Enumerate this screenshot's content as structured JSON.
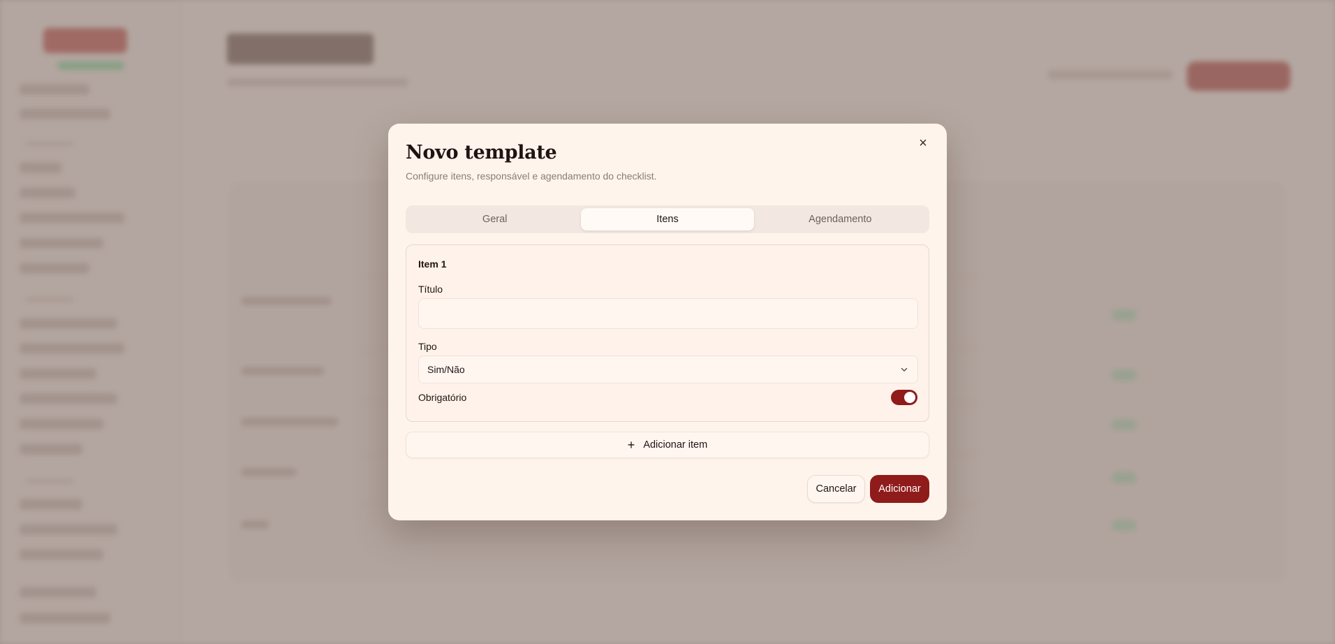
{
  "modal": {
    "title": "Novo template",
    "description": "Configure itens, responsável e agendamento do checklist.",
    "close_icon": "×",
    "tabs": [
      {
        "label": "Geral",
        "active": false
      },
      {
        "label": "Itens",
        "active": true
      },
      {
        "label": "Agendamento",
        "active": false
      }
    ],
    "item": {
      "label": "Item 1",
      "title_label": "Título",
      "title_value": "",
      "type_label": "Tipo",
      "type_value": "Sim/Não",
      "required_label": "Obrigatório",
      "required_on": true
    },
    "add_item_icon": "+",
    "add_item_label": "Adicionar item",
    "cancel_label": "Cancelar",
    "submit_label": "Adicionar"
  },
  "colors": {
    "accent": "#8f1c1a",
    "modal_bg": "#fff4ec"
  }
}
